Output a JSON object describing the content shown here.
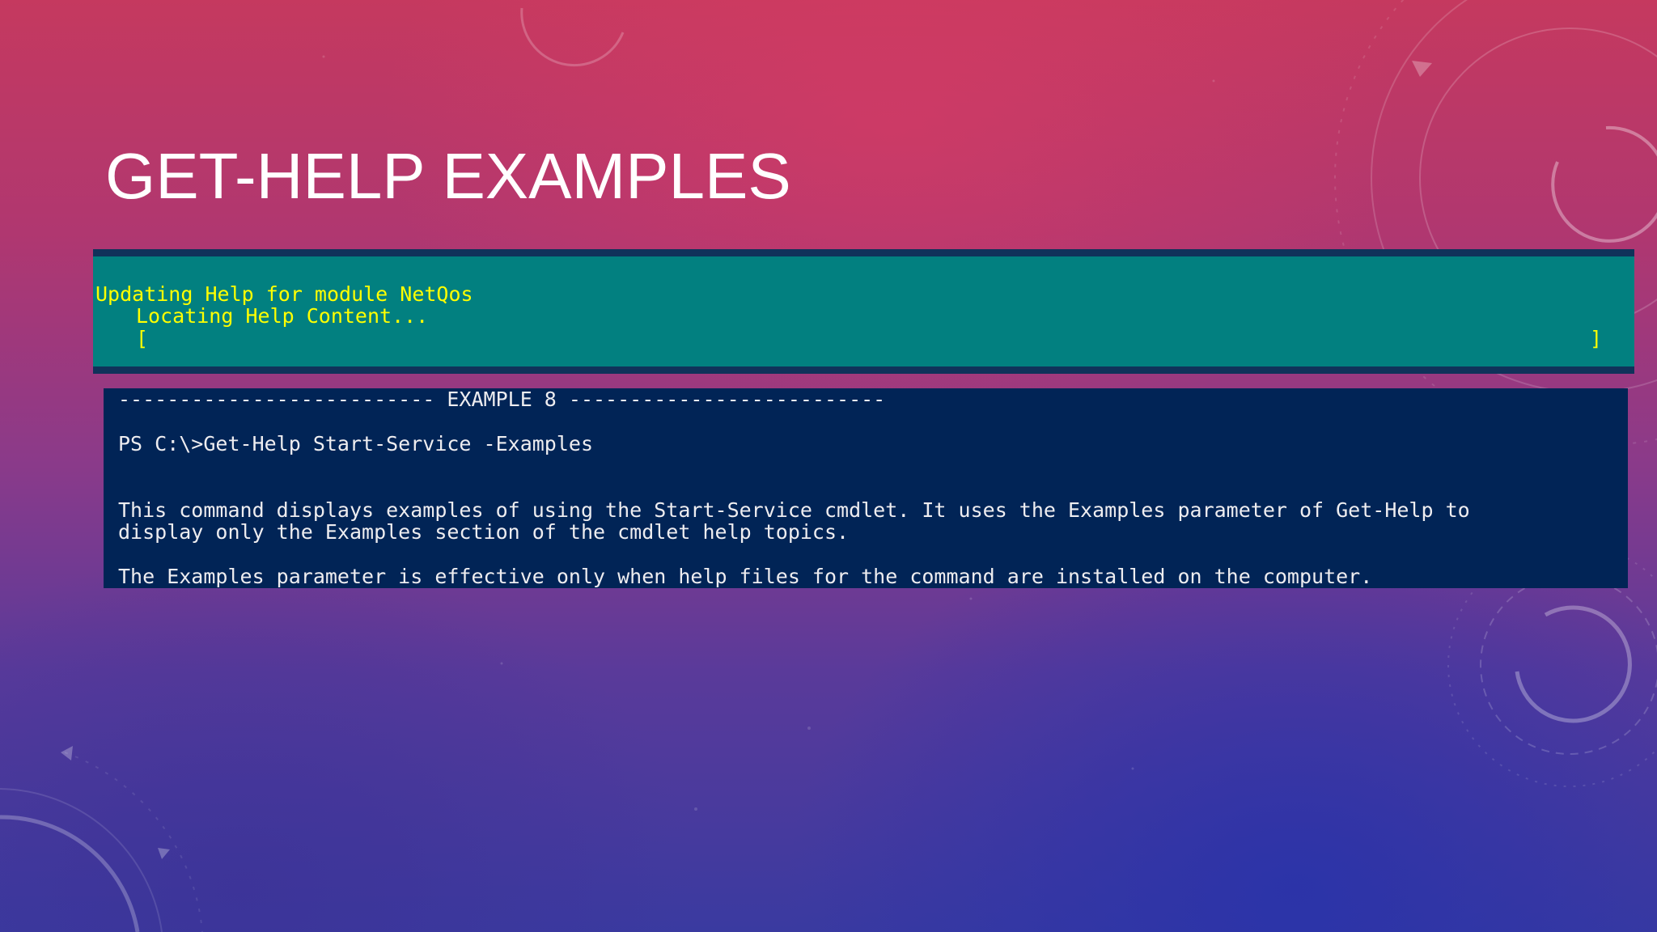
{
  "slide": {
    "title": "GET-HELP EXAMPLES"
  },
  "progress_panel": {
    "line1": "Updating Help for module NetQos",
    "line2": "Locating Help Content...",
    "bracket_open": "[",
    "bracket_close": "]"
  },
  "console": {
    "example_header": "-------------------------- EXAMPLE 8 --------------------------",
    "command": "PS C:\\>Get-Help Start-Service -Examples",
    "description_line1": "This command displays examples of using the Start-Service cmdlet. It uses the Examples parameter of Get-Help to",
    "description_line2": "display only the Examples section of the cmdlet help topics.",
    "description_line3": "The Examples parameter is effective only when help files for the command are installed on the computer."
  },
  "colors": {
    "progress_background": "#028080",
    "progress_text": "#ffff00",
    "console_background": "#012456",
    "console_text": "#eeedf0",
    "title_text": "#ffffff"
  }
}
